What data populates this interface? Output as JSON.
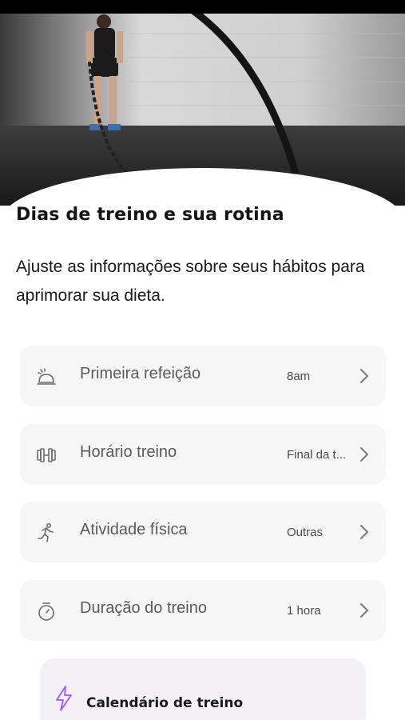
{
  "header": {
    "title": "Dias de treino e sua rotina",
    "subtitle": "Ajuste as informações sobre seus hábitos para aprimorar sua dieta."
  },
  "settings": [
    {
      "label": "Primeira refeição",
      "value": "8am",
      "icon": "breakfast-icon"
    },
    {
      "label": "Horário treino",
      "value": "Final da t...",
      "icon": "dumbbell-icon"
    },
    {
      "label": "Atividade física",
      "value": "Outras",
      "icon": "running-icon"
    },
    {
      "label": "Duração do treino",
      "value": "1 hora",
      "icon": "stopwatch-icon"
    }
  ],
  "calendar": {
    "label": "Calendário de treino",
    "icon": "lightning-icon",
    "accent": "#a855f7"
  },
  "colors": {
    "row_background": "#f6f6f6",
    "card_background": "#f3f1f6",
    "text_primary": "#141414",
    "text_secondary": "#5a5a5a"
  }
}
